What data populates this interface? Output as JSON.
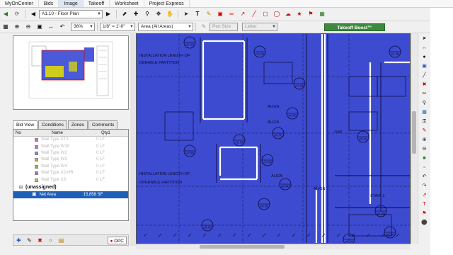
{
  "menu": [
    "MyOnCenter",
    "Bids",
    "Image",
    "Takeoff",
    "Worksheet",
    "Project Express"
  ],
  "menu_active": 2,
  "toolbar1": {
    "page_combo": "A1.10 - Floor Plan",
    "icons": [
      "back-icon",
      "refresh-icon",
      "prev-page-icon",
      "next-page-icon",
      "select-icon",
      "crosshair-icon",
      "zoom-icon",
      "pan-icon",
      "hand-icon",
      "pointer-icon",
      "text-icon",
      "highlight-icon",
      "stamp-icon",
      "link-icon",
      "arrow-icon",
      "line-icon",
      "rectangle-icon",
      "ellipse-icon",
      "cloud-icon",
      "callout-icon",
      "flag-icon",
      "layers-icon"
    ]
  },
  "toolbar2": {
    "zoom": "36%",
    "scale": "1/8\" = 1'-0\"",
    "area_mode": "Area (All Areas)",
    "pen_size": "Pen Size",
    "style": "Letter",
    "boost_label": "Takeoff Boost™"
  },
  "left_tabs": [
    "Bid View",
    "Conditions",
    "Zones",
    "Comments"
  ],
  "left_tab_active": 0,
  "cond_headers": [
    "No",
    "Name",
    "Qty1"
  ],
  "conditions": [
    {
      "name": "Wall Type ST3",
      "qty": "0 LF",
      "color": "#e060c0"
    },
    {
      "name": "Wall Type W18",
      "qty": "0 LF",
      "color": "#d070d0"
    },
    {
      "name": "Wall Type W2",
      "qty": "0 LF",
      "color": "#8080e0"
    },
    {
      "name": "Wall Type W3",
      "qty": "0 LF",
      "color": "#e0a040"
    },
    {
      "name": "Wall Type W4",
      "qty": "0 LF",
      "color": "#80c040"
    },
    {
      "name": "Wall Type X2-HR",
      "qty": "0 LF",
      "color": "#c060c0"
    },
    {
      "name": "Wall Type X3",
      "qty": "0 LF",
      "color": "#c0c040"
    }
  ],
  "group_label": "(unassigned)",
  "selected_row": {
    "name": "Net Area",
    "qty": "15,858 SF"
  },
  "bottom_btn": "DPC",
  "plan_labels": [
    "INSTALLATION LENGTH OF",
    "DERABLE PARTITION",
    "INSTALLATION LENGTH OF",
    "OPERABLE PARTITION",
    "ALIGN",
    "ALIGN",
    "ALIGN",
    "ALIGN",
    "SIM",
    "STAIR 1"
  ],
  "tags": [
    "A2.00",
    "A3.00",
    "A7.00",
    "A8.00",
    "A9.00",
    "A5.00",
    "A2.00",
    "A6.00",
    "A8.00",
    "A7.00",
    "A8.00",
    "A7.00",
    "A8.00",
    "A5.00",
    "A6.00",
    "A1.00"
  ],
  "colors": {
    "canvas_bg": "#3d4bd0",
    "line": "#0a0a3a",
    "wall": "#ffffff",
    "boost": "#3d8a3d",
    "select": "#1f5fb8"
  }
}
